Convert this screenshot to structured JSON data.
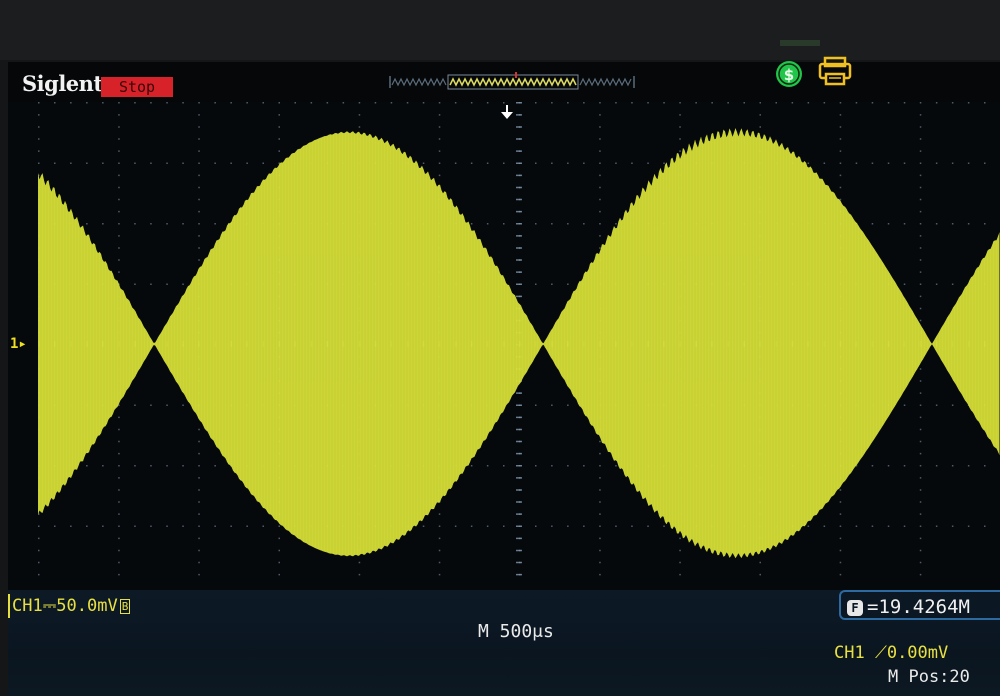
{
  "colors": {
    "trace": "#d9e23a",
    "trace_dark": "#b8c22a",
    "grid_dots": "#8aa0b8",
    "stop_badge": "#d8222a",
    "usb_green": "#22c44a",
    "printer_yellow": "#f0c020"
  },
  "header": {
    "brand": "Siglent",
    "run_status": "Stop"
  },
  "icons": {
    "trigger_position": "arrow-down-icon",
    "usb": "usb-icon",
    "printer": "printer-icon",
    "ch1_level": "ch1-ground-marker"
  },
  "waveform": {
    "type": "amplitude-modulated",
    "modulation_minima_divisions_from_left": [
      1.45,
      6.3
    ],
    "peak_amplitude_divisions": 3.5
  },
  "channel": {
    "label": "CH1",
    "coupling_symbol": "⎓",
    "scale": "50.0mV",
    "bandwidth_badge": "B",
    "level_marker": "1▸"
  },
  "measurement": {
    "icon": "F",
    "value": "=19.4264M"
  },
  "timebase": {
    "label": "M 500μs"
  },
  "trigger": {
    "label": "CH1 ⟋0.00mV"
  },
  "horizontal": {
    "label": "M Pos:20"
  }
}
